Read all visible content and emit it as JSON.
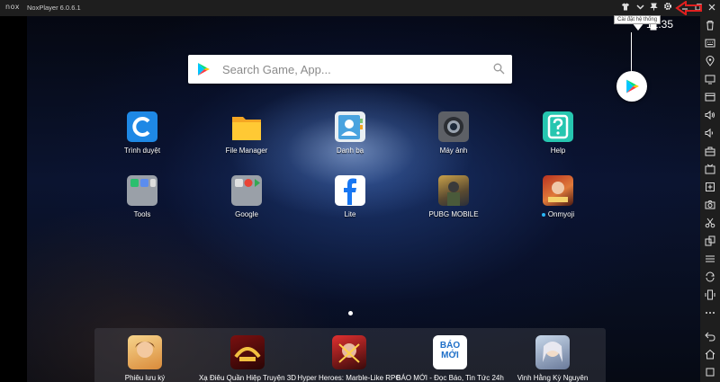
{
  "window": {
    "logo": "nox",
    "title": "NoxPlayer 6.0.6.1",
    "tooltip": "Cài đặt hệ thống",
    "highlight_color": "#e02020",
    "controls": [
      "shirt-icon",
      "chevron-down-icon",
      "pin-icon",
      "gear-icon",
      "minimize-icon",
      "restore-icon",
      "close-icon"
    ]
  },
  "status": {
    "time": "12:35"
  },
  "search": {
    "placeholder": "Search Game, App..."
  },
  "apps": [
    {
      "label": "Trình duyệt",
      "icon": "browser-icon"
    },
    {
      "label": "File Manager",
      "icon": "folder-icon"
    },
    {
      "label": "Danh bạ",
      "icon": "contacts-icon"
    },
    {
      "label": "Máy ảnh",
      "icon": "camera-icon"
    },
    {
      "label": "Help",
      "icon": "help-icon"
    },
    {
      "label": "Tools",
      "icon": "tools-folder-icon"
    },
    {
      "label": "Google",
      "icon": "google-folder-icon"
    },
    {
      "label": "Lite",
      "icon": "facebook-icon"
    },
    {
      "label": "PUBG MOBILE",
      "icon": "pubg-icon"
    },
    {
      "label": "Onmyoji",
      "icon": "onmyoji-icon"
    }
  ],
  "dock": [
    {
      "label": "Phiêu lưu ký",
      "icon": "game-icon"
    },
    {
      "label": "Xạ Điêu Quần Hiệp Truyện 3D",
      "icon": "game-icon"
    },
    {
      "label": "Hyper Heroes: Marble-Like RPG",
      "icon": "game-icon"
    },
    {
      "label": "BÁO MỚI - Đọc Báo, Tin Tức 24h",
      "icon": "news-icon",
      "icon_text": "BÁO MỚI"
    },
    {
      "label": "Vinh Hằng Kỳ Nguyên",
      "icon": "game-icon"
    }
  ],
  "sidebar": [
    "trash-icon",
    "keyboard-icon",
    "location-icon",
    "screen-icon",
    "apk-icon",
    "volume-up-icon",
    "volume-down-icon",
    "toolbox-icon",
    "record-icon",
    "scissors-icon",
    "multi-instance-icon",
    "shake-icon",
    "sync-icon",
    "more-icon",
    "back-icon",
    "home-icon",
    "recent-icon"
  ]
}
